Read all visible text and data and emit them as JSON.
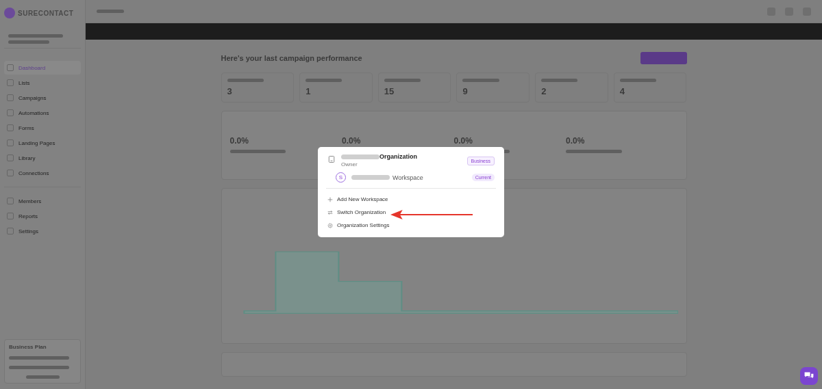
{
  "sidebar": {
    "brand": "SURECONTACT",
    "items": [
      {
        "label": "Dashboard",
        "selected": true
      },
      {
        "label": "Lists",
        "selected": false
      },
      {
        "label": "Campaigns",
        "selected": false
      },
      {
        "label": "Automations",
        "selected": false
      },
      {
        "label": "Forms",
        "selected": false
      },
      {
        "label": "Landing Pages",
        "selected": false
      },
      {
        "label": "Library",
        "selected": false
      },
      {
        "label": "Connections",
        "selected": false
      },
      {
        "label": "Members",
        "selected": false
      },
      {
        "label": "Reports",
        "selected": false
      },
      {
        "label": "Settings",
        "selected": false
      }
    ],
    "plan": {
      "title": "Business Plan"
    }
  },
  "main": {
    "heading": "Here's your last campaign performance",
    "stats": [
      {
        "value": "3"
      },
      {
        "value": "1"
      },
      {
        "value": "15"
      },
      {
        "value": "9"
      },
      {
        "value": "2"
      },
      {
        "value": "4"
      }
    ],
    "rates": [
      "0.0%",
      "0.0%",
      "0.0%",
      "0.0%"
    ]
  },
  "popup": {
    "organization": {
      "name": "Organization",
      "role": "Owner",
      "badge": "Business"
    },
    "workspace": {
      "initial": "S",
      "name": "Workspace",
      "badge": "Current"
    },
    "actions": [
      {
        "kind": "add",
        "label": "Add New Workspace"
      },
      {
        "kind": "switch",
        "label": "Switch Organization"
      },
      {
        "kind": "settings",
        "label": "Organization Settings"
      }
    ]
  }
}
